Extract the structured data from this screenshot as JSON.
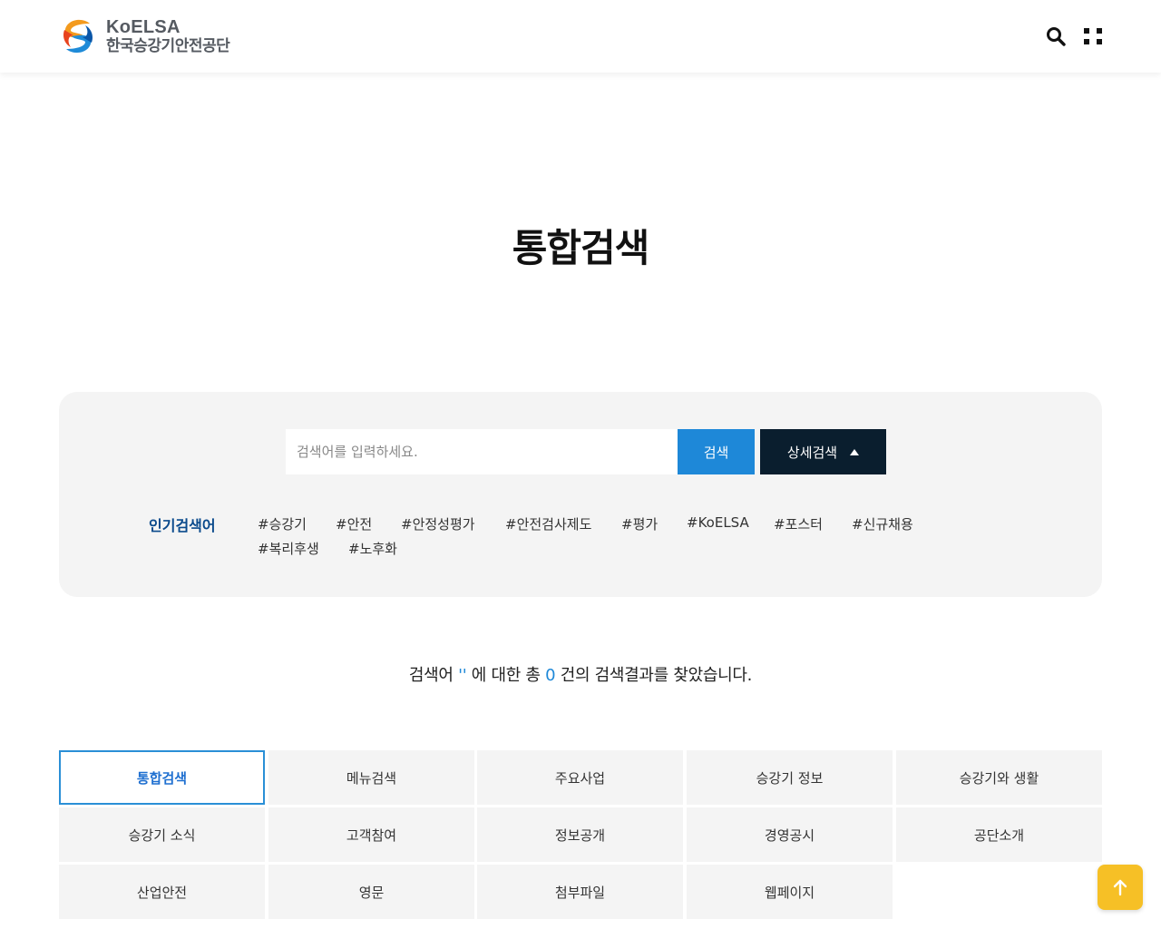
{
  "header": {
    "logo_en": "KoELSA",
    "logo_ko": "한국승강기안전공단",
    "search_icon": "search-icon",
    "menu_icon": "grid-menu-icon"
  },
  "page_title": "통합검색",
  "search": {
    "placeholder": "검색어를 입력하세요.",
    "value": "",
    "search_button": "검색",
    "advanced_button": "상세검색",
    "advanced_icon": "triangle-up-icon"
  },
  "popular": {
    "label": "인기검색어",
    "tags": [
      "#승강기",
      "#안전",
      "#안정성평가",
      "#안전검사제도",
      "#평가",
      "#KoELSA",
      "#포스터",
      "#신규채용",
      "#복리후생",
      "#노후화"
    ]
  },
  "result": {
    "prefix": "검색어 ",
    "quote": "''",
    "middle": " 에 대한 총 ",
    "count": "0",
    "suffix": " 건의 검색결과를 찾았습니다."
  },
  "categories": [
    "통합검색",
    "메뉴검색",
    "주요사업",
    "승강기 정보",
    "승강기와 생활",
    "승강기 소식",
    "고객참여",
    "정보공개",
    "경영공시",
    "공단소개",
    "산업안전",
    "영문",
    "첨부파일",
    "웹페이지"
  ],
  "active_category": "통합검색",
  "colors": {
    "accent": "#1e88d8",
    "dark_button": "#0a1e2e",
    "popular_label": "#0a4a8c",
    "top_button": "#f6c026"
  },
  "top_button_icon": "arrow-up-icon"
}
